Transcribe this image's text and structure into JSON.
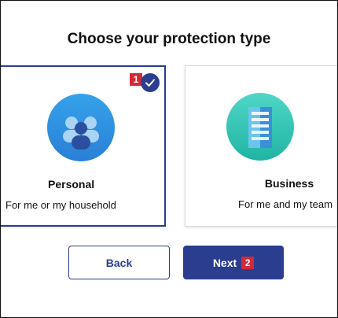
{
  "page": {
    "title": "Choose your protection type"
  },
  "options": [
    {
      "name": "Personal",
      "description": "For me or my household",
      "icon": "people-icon",
      "selected": true,
      "marker": "1"
    },
    {
      "name": "Business",
      "description": "For me and my team",
      "icon": "building-icon",
      "selected": false
    }
  ],
  "buttons": {
    "back_label": "Back",
    "next_label": "Next",
    "next_marker": "2"
  },
  "colors": {
    "accent": "#2a3d8f",
    "marker": "#d62839",
    "personal_icon_bg": "#2f8ee0",
    "business_icon_bg": "#2bc0b0"
  }
}
